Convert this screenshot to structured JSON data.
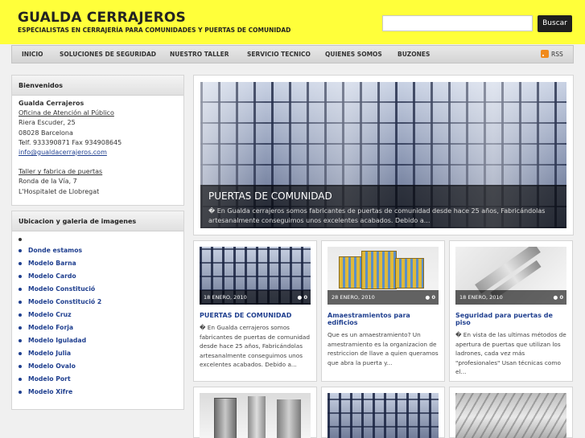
{
  "header": {
    "title": "GUALDA CERRAJEROS",
    "tagline": "ESPECIALISTAS EN CERRAJERÍA PARA COMUNIDADES Y PUERTAS DE COMUNIDAD",
    "search_value": "",
    "search_button": "Buscar",
    "bg_color": "#ffff3a"
  },
  "nav": {
    "items": [
      "INICIO",
      "SOLUCIONES DE SEGURIDAD",
      "NUESTRO TALLER",
      "SERVICIO TECNICO",
      "QUIENES SOMOS",
      "BUZONES"
    ],
    "rss": "RSS",
    "rss_icon": "rss-feed-icon"
  },
  "sidebar": {
    "welcome": {
      "title": "Bienvenidos",
      "company": "Gualda Cerrajeros",
      "office": "Oficina de Atención al Público",
      "street": "Riera Escuder, 25",
      "city": "08028 Barcelona",
      "phones": "Telf. 933390871 Fax 934908645",
      "email": "info@gualdacerrajeros.com",
      "workshop": "Taller y fabrica de puertas",
      "workshop_street": "Ronda de la Vía, 7",
      "workshop_city": "L'Hospitalet de Llobregat"
    },
    "gallery": {
      "title": "Ubicacion y galeria de imagenes",
      "items": [
        "Donde estamos",
        "Modelo Barna",
        "Modelo Cardo",
        "Modelo Constitució",
        "Modelo Constitució 2",
        "Modelo Cruz",
        "Modelo Forja",
        "Modelo Iguladad",
        "Modelo Julia",
        "Modelo Ovalo",
        "Modelo Port",
        "Modelo Xifre"
      ]
    }
  },
  "featured": {
    "title": "PUERTAS DE COMUNIDAD",
    "excerpt": "� En Gualda cerrajeros somos fabricantes de puertas  de comunidad desde hace 25 años, Fabricándolas artesanalmente conseguimos unos excelentes acabados. Debido a..."
  },
  "posts": [
    {
      "date": "18 ENERO, 2010",
      "comments": "0",
      "title": "PUERTAS DE COMUNIDAD",
      "excerpt": "� En Gualda cerrajeros somos fabricantes de puertas  de comunidad desde hace 25 años, Fabricándolas artesanalmente conseguimos unos excelentes acabados. Debido a..."
    },
    {
      "date": "28 ENERO, 2010",
      "comments": "0",
      "title": "Amaestramientos para edificios",
      "excerpt": "Que es un amaestramiento? Un amestramiento es la organizacion de restriccion de llave a quien queramos que abra la puerta y..."
    },
    {
      "date": "18 ENERO, 2010",
      "comments": "0",
      "title": "Seguridad para puertas de piso",
      "excerpt": "� En vista de las ultimas métodos de apertura de puertas que utilizan los ladrones, cada vez más \"profesionales\" Usan técnicas como el..."
    }
  ],
  "colors": {
    "accent": "#ffff3a",
    "link": "#1f3f8f"
  }
}
